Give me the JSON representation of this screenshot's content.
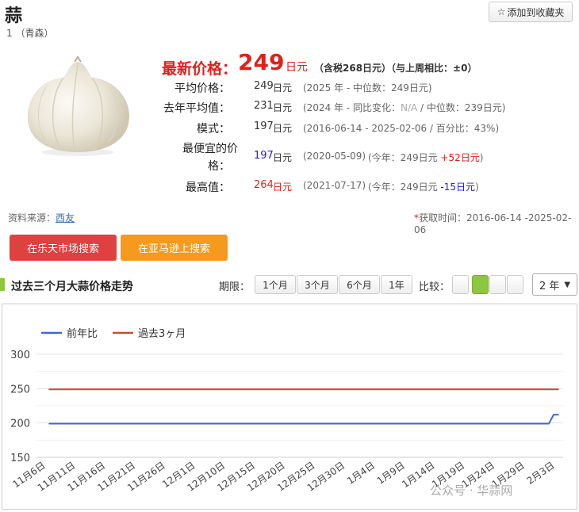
{
  "header": {
    "title": "蒜",
    "subtitle": "1 （青森）",
    "fav_label": "添加到收藏夹"
  },
  "latest": {
    "label": "最新价格：",
    "price": "249",
    "unit": "日元",
    "note": "（含税268日元）（与上周相比：±0）"
  },
  "stats": [
    {
      "label": "平均价格：",
      "value": "249",
      "value_color": "#333333",
      "unit": "日元",
      "note": "(2025 年 - 中位数：249日元)"
    },
    {
      "label": "去年平均值：",
      "value": "231",
      "value_color": "#333333",
      "unit": "日元",
      "note_a": "(2024 年 - 同比变化：",
      "note_na": "N/A",
      "note_b": " / 中位数：239日元)"
    },
    {
      "label": "模式：",
      "value": "197",
      "value_color": "#333333",
      "unit": "日元",
      "note": "(2016-06-14 - 2025-02-06 / 百分比：43%)"
    },
    {
      "label_1": "最便宜的价",
      "label_2": "格：",
      "value": "197",
      "value_color": "#2222cc",
      "unit": "日元",
      "note": "(2020-05-09)",
      "note2_a": "(今年：249日元 ",
      "note2_delta": "+52日元",
      "note2_b": ")",
      "delta_color": "#e0211b"
    },
    {
      "label": "最高值：",
      "value": "264",
      "value_color": "#e0211b",
      "unit": "日元",
      "note": "(2021-07-17)",
      "note2_a": "(今年：249日元 ",
      "note2_delta": "-15日元",
      "note2_b": ")",
      "delta_color": "#2222cc"
    }
  ],
  "source": {
    "label": "资料来源：",
    "link": "西友"
  },
  "fetch_time": {
    "star": "*",
    "text": "获取时间：2016-06-14 -2025-02-06"
  },
  "buttons": {
    "rakuten": "在乐天市场搜索",
    "amazon": "在亚马逊上搜索"
  },
  "section": {
    "title": "过去三个月大蒜价格走势",
    "period_label": "期限：",
    "periods": [
      "1个月",
      "3个月",
      "6个月",
      "1年"
    ],
    "compare_label": "比较：",
    "select_value": "2 年"
  },
  "watermark": "公众号 · 华蒜网",
  "colors": {
    "accent_red": "#e0211b",
    "green": "#8dc63f",
    "line_prev_year": "#4466cc",
    "line_3month": "#c0502a"
  },
  "chart_data": {
    "type": "line",
    "x": [
      "11月6日",
      "11月11日",
      "11月16日",
      "11月21日",
      "11月26日",
      "12月1日",
      "12月10日",
      "12月15日",
      "12月20日",
      "12月25日",
      "12月30日",
      "1月4日",
      "1月9日",
      "1月14日",
      "1月19日",
      "1月24日",
      "1月29日",
      "2月3日"
    ],
    "series": [
      {
        "name": "前年比",
        "color": "#4466cc",
        "values": [
          199,
          199,
          199,
          199,
          199,
          199,
          199,
          199,
          199,
          199,
          199,
          199,
          199,
          199,
          199,
          199,
          199,
          212
        ]
      },
      {
        "name": "過去3ヶ月",
        "color": "#c0502a",
        "values": [
          249,
          249,
          249,
          249,
          249,
          249,
          249,
          249,
          249,
          249,
          249,
          249,
          249,
          249,
          249,
          249,
          249,
          249
        ]
      }
    ],
    "yticks": [
      150,
      200,
      250,
      300
    ],
    "ylim": [
      150,
      300
    ],
    "grid": true,
    "legend": "top-left"
  }
}
